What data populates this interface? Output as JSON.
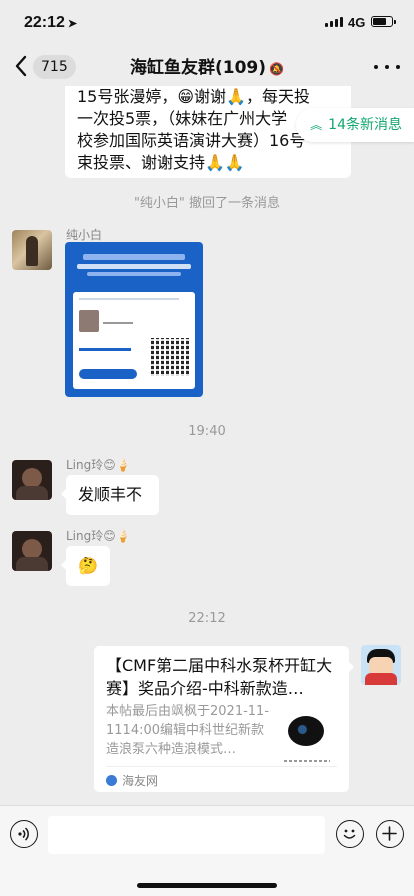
{
  "status_bar": {
    "time": "22:12",
    "location_glyph": "➤",
    "network": "4G"
  },
  "nav": {
    "unread_count": "715",
    "title": "海缸鱼友群(109)",
    "mute_glyph": "🔕"
  },
  "messages": {
    "partial_bubble_lines": [
      "15号张漫婷，😁谢谢🙏，每天投",
      "一次投5票，（妹妹在广州大学",
      "校参加国际英语演讲大赛）16号",
      "束投票、谢谢支持🙏🙏"
    ],
    "new_messages_badge": "14条新消息",
    "recall_notice": "\"纯小白\" 撤回了一条消息",
    "msg_poster_sender": "纯小白",
    "time_1": "19:40",
    "msg_2_sender": "Ling玲😊🍦",
    "msg_2_text": "发顺丰不",
    "msg_3_sender": "Ling玲😊🍦",
    "msg_3_emoji": "🤔",
    "time_2": "22:12",
    "link_card": {
      "title": "【CMF第二届中科水泵杯开缸大赛】奖品介绍-中科新款造…",
      "desc": "本帖最后由飒枫于2021-11-1114:00编辑中科世纪新款造浪泵六种造浪模式…",
      "source": "海友网"
    }
  },
  "input_bar": {
    "placeholder": ""
  },
  "icons": {
    "back": "chevron-left-icon",
    "more": "more-dots-icon",
    "voice": "voice-icon",
    "emoji": "emoji-icon",
    "plus": "plus-icon"
  }
}
